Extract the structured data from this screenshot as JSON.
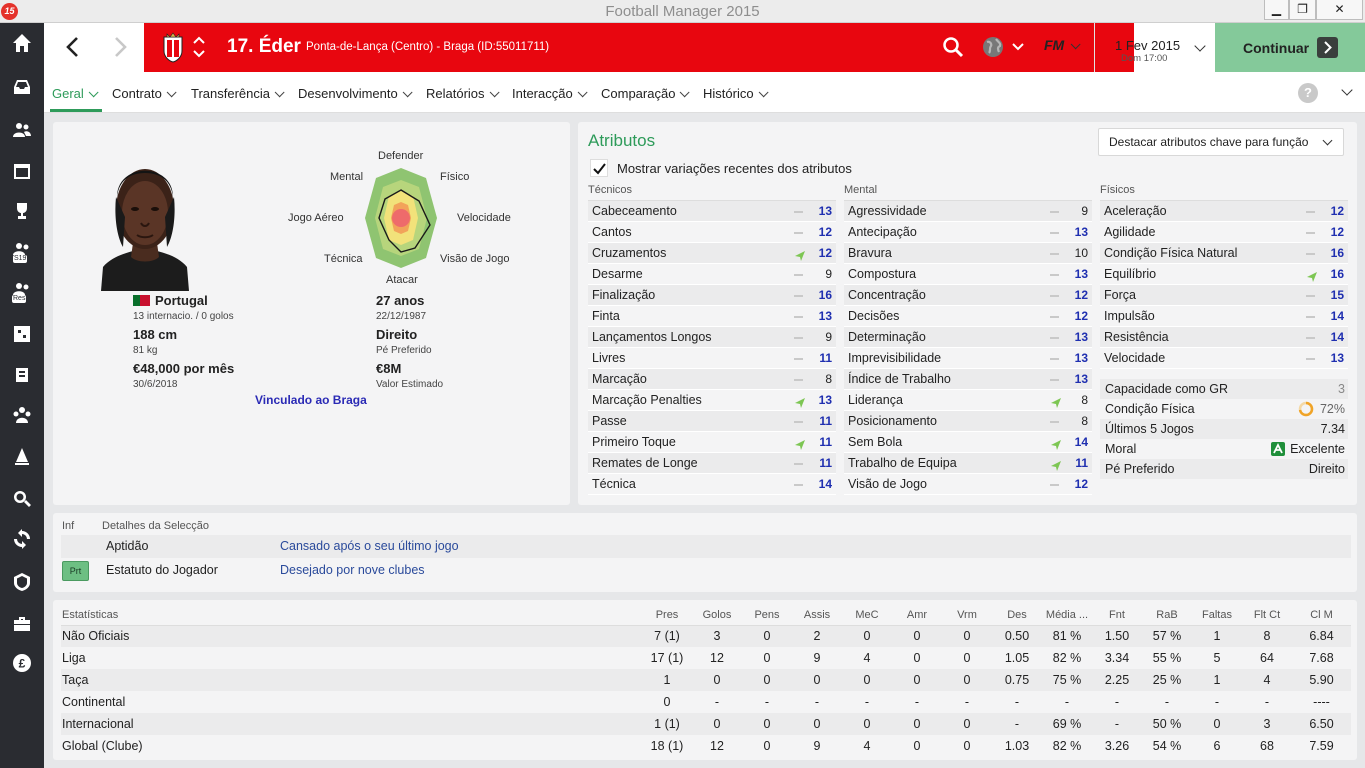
{
  "window": {
    "title": "Football Manager 2015",
    "logo": "15"
  },
  "header": {
    "player_name": "17. Éder",
    "player_sub": "Ponta-de-Lança (Centro) - Braga (ID:55011711)",
    "fm_label": "FM",
    "date": "1 Fev 2015",
    "time": "Dom 17:00",
    "continue": "Continuar",
    "banner_color": "#e8060f"
  },
  "tabs": [
    "Geral",
    "Contrato",
    "Transferência",
    "Desenvolvimento",
    "Relatórios",
    "Interacção",
    "Comparação",
    "Histórico"
  ],
  "help": "?",
  "profile": {
    "nationality": "Portugal",
    "caps": "13 internacio. / 0 golos",
    "height": "188 cm",
    "weight": "81 kg",
    "wage": "€48,000 por mês",
    "contract_end": "30/6/2018",
    "age": "27 anos",
    "dob": "22/12/1987",
    "foot": "Direito",
    "foot_label": "Pé Preferido",
    "value": "€8M",
    "value_label": "Valor Estimado",
    "club_link": "Vinculado ao Braga",
    "radar_labels": {
      "defender": "Defender",
      "fisico": "Físico",
      "velocidade": "Velocidade",
      "visao": "Visão de Jogo",
      "atacar": "Atacar",
      "tecnica": "Técnica",
      "aereo": "Jogo Aéreo",
      "mental": "Mental"
    }
  },
  "attributes": {
    "title": "Atributos",
    "highlight_dropdown": "Destacar atributos chave para função",
    "show_changes_label": "Mostrar variações recentes dos atributos",
    "tecnicos": {
      "header": "Técnicos",
      "rows": [
        {
          "name": "Cabeceamento",
          "value": "13",
          "trend": "none"
        },
        {
          "name": "Cantos",
          "value": "12",
          "trend": "none"
        },
        {
          "name": "Cruzamentos",
          "value": "12",
          "trend": "up"
        },
        {
          "name": "Desarme",
          "value": "9",
          "trend": "none"
        },
        {
          "name": "Finalização",
          "value": "16",
          "trend": "none"
        },
        {
          "name": "Finta",
          "value": "13",
          "trend": "none"
        },
        {
          "name": "Lançamentos Longos",
          "value": "9",
          "trend": "none"
        },
        {
          "name": "Livres",
          "value": "11",
          "trend": "none"
        },
        {
          "name": "Marcação",
          "value": "8",
          "trend": "none"
        },
        {
          "name": "Marcação Penalties",
          "value": "13",
          "trend": "up"
        },
        {
          "name": "Passe",
          "value": "11",
          "trend": "none"
        },
        {
          "name": "Primeiro Toque",
          "value": "11",
          "trend": "up"
        },
        {
          "name": "Remates de Longe",
          "value": "11",
          "trend": "none"
        },
        {
          "name": "Técnica",
          "value": "14",
          "trend": "none"
        }
      ]
    },
    "mental": {
      "header": "Mental",
      "rows": [
        {
          "name": "Agressividade",
          "value": "9",
          "trend": "none"
        },
        {
          "name": "Antecipação",
          "value": "13",
          "trend": "none"
        },
        {
          "name": "Bravura",
          "value": "10",
          "trend": "none"
        },
        {
          "name": "Compostura",
          "value": "13",
          "trend": "none"
        },
        {
          "name": "Concentração",
          "value": "12",
          "trend": "none"
        },
        {
          "name": "Decisões",
          "value": "12",
          "trend": "none"
        },
        {
          "name": "Determinação",
          "value": "13",
          "trend": "none"
        },
        {
          "name": "Imprevisibilidade",
          "value": "13",
          "trend": "none"
        },
        {
          "name": "Índice de Trabalho",
          "value": "13",
          "trend": "none"
        },
        {
          "name": "Liderança",
          "value": "8",
          "trend": "up"
        },
        {
          "name": "Posicionamento",
          "value": "8",
          "trend": "none"
        },
        {
          "name": "Sem Bola",
          "value": "14",
          "trend": "up"
        },
        {
          "name": "Trabalho de Equipa",
          "value": "11",
          "trend": "up"
        },
        {
          "name": "Visão de Jogo",
          "value": "12",
          "trend": "none"
        }
      ]
    },
    "fisicos": {
      "header": "Físicos",
      "rows": [
        {
          "name": "Aceleração",
          "value": "12",
          "trend": "none"
        },
        {
          "name": "Agilidade",
          "value": "12",
          "trend": "none"
        },
        {
          "name": "Condição Física Natural",
          "value": "16",
          "trend": "none"
        },
        {
          "name": "Equilíbrio",
          "value": "16",
          "trend": "up"
        },
        {
          "name": "Força",
          "value": "15",
          "trend": "none"
        },
        {
          "name": "Impulsão",
          "value": "14",
          "trend": "none"
        },
        {
          "name": "Resistência",
          "value": "14",
          "trend": "none"
        },
        {
          "name": "Velocidade",
          "value": "13",
          "trend": "none"
        }
      ]
    },
    "info": [
      {
        "label": "Capacidade como GR",
        "value": "3"
      },
      {
        "label": "Condição Física",
        "value": "72%"
      },
      {
        "label": "Últimos 5 Jogos",
        "value": "7.34"
      },
      {
        "label": "Moral",
        "value": "Excelente"
      },
      {
        "label": "Pé Preferido",
        "value": "Direito"
      }
    ],
    "condition_fraction": 0.72
  },
  "selection": {
    "head_inf": "Inf",
    "head_title": "Detalhes da Selecção",
    "rows": [
      {
        "label": "Aptidão",
        "value": "Cansado após o seu último jogo"
      },
      {
        "label": "Estatuto do Jogador",
        "value": "Desejado por nove clubes",
        "badge": "Prt"
      }
    ]
  },
  "stats": {
    "columns": [
      "Estatísticas",
      "Pres",
      "Golos",
      "Pens",
      "Assis",
      "MeC",
      "Amr",
      "Vrm",
      "Des",
      "Média ...",
      "Fnt",
      "RaB",
      "Faltas",
      "Flt Ct",
      "Cl M"
    ],
    "rows": [
      [
        "Não Oficiais",
        "7 (1)",
        "3",
        "0",
        "2",
        "0",
        "0",
        "0",
        "0.50",
        "81 %",
        "1.50",
        "57 %",
        "1",
        "8",
        "6.84"
      ],
      [
        "Liga",
        "17 (1)",
        "12",
        "0",
        "9",
        "4",
        "0",
        "0",
        "1.05",
        "82 %",
        "3.34",
        "55 %",
        "5",
        "64",
        "7.68"
      ],
      [
        "Taça",
        "1",
        "0",
        "0",
        "0",
        "0",
        "0",
        "0",
        "0.75",
        "75 %",
        "2.25",
        "25 %",
        "1",
        "4",
        "5.90"
      ],
      [
        "Continental",
        "0",
        "-",
        "-",
        "-",
        "-",
        "-",
        "-",
        "-",
        "-",
        "-",
        "-",
        "-",
        "-",
        "----"
      ],
      [
        "Internacional",
        "1 (1)",
        "0",
        "0",
        "0",
        "0",
        "0",
        "0",
        "-",
        "69 %",
        "-",
        "50 %",
        "0",
        "3",
        "6.50"
      ],
      [
        "Global (Clube)",
        "18 (1)",
        "12",
        "0",
        "9",
        "4",
        "0",
        "0",
        "1.03",
        "82 %",
        "3.26",
        "54 %",
        "6",
        "68",
        "7.59"
      ]
    ]
  },
  "sidebar_icons": [
    "home-icon",
    "inbox-icon",
    "squad-icon",
    "calendar-icon",
    "trophy-icon",
    "u19-squad-icon",
    "reserves-icon",
    "tactics-icon",
    "training-icon",
    "staff-icon",
    "match-icon",
    "search-icon",
    "transfers-icon",
    "scouting-icon",
    "finances-icon",
    "money-icon"
  ],
  "sidebar_badges": {
    "u19": "S19",
    "reserves": "Res"
  }
}
